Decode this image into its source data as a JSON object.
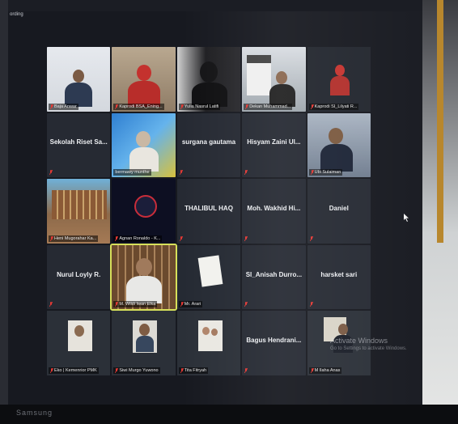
{
  "window": {
    "title_fragment": "ording"
  },
  "participants": [
    {
      "name": "Baja Anwar",
      "kind": "video"
    },
    {
      "name": "Kaprodi BSA_Ening...",
      "kind": "video"
    },
    {
      "name": "Yulia Nasrul Latifi",
      "kind": "video"
    },
    {
      "name": "Dekan Muhammad...",
      "kind": "video"
    },
    {
      "name": "Kaprodi SI_Lilyati R...",
      "kind": "video"
    },
    {
      "name": "Sekolah Riset Sa...",
      "kind": "name"
    },
    {
      "name": "bermawy munthe",
      "kind": "video"
    },
    {
      "name": "surgana gautama",
      "kind": "name"
    },
    {
      "name": "Hisyam Zaini Ul...",
      "kind": "name"
    },
    {
      "name": "Ubi Sulaiman",
      "kind": "video"
    },
    {
      "name": "Heni Mugorahar Ka...",
      "kind": "video"
    },
    {
      "name": "Agnan Ronaldo - K...",
      "kind": "video"
    },
    {
      "name": "THALIBUL HAQ",
      "kind": "name"
    },
    {
      "name": "Moh. Wakhid Hi...",
      "kind": "name"
    },
    {
      "name": "Daniel",
      "kind": "name"
    },
    {
      "name": "Nurul Loyly R.",
      "kind": "name"
    },
    {
      "name": "M. Wildi Iwan Elka",
      "kind": "video"
    },
    {
      "name": "Mr. Arari",
      "kind": "video"
    },
    {
      "name": "Sl_Anisah Durro...",
      "kind": "name"
    },
    {
      "name": "harsket sari",
      "kind": "name"
    },
    {
      "name": "Eko | Kemenrior PMK",
      "kind": "video"
    },
    {
      "name": "Siwi Murgo Yuwono",
      "kind": "video"
    },
    {
      "name": "Tita Fitryah",
      "kind": "video"
    },
    {
      "name": "Bagus Hendrani...",
      "kind": "name"
    },
    {
      "name": "M Ilaha Anas",
      "kind": "video"
    }
  ],
  "watermark": {
    "line1": "Activate Windows",
    "line2": "Go to Settings to activate Windows."
  },
  "bezel_text": "Samsung",
  "colors": {
    "muted_mic": "#e53935",
    "tile_bg": "#262a33"
  }
}
